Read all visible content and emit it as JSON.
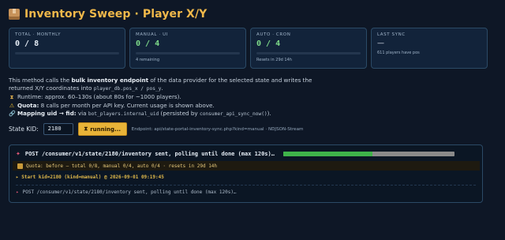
{
  "header": {
    "title": "Inventory Sweep · Player X/Y",
    "icon": "package-box-icon"
  },
  "cards": [
    {
      "label": "TOTAL · MONTHLY",
      "value": "0 / 8",
      "sub": "",
      "progress": 0
    },
    {
      "label": "MANUAL · UI",
      "value": "0 / 4",
      "sub": "4 remaining",
      "progress": 0
    },
    {
      "label": "AUTO · CRON",
      "value": "0 / 4",
      "sub": "Resets in 29d 14h",
      "progress": 0
    },
    {
      "label": "LAST SYNC",
      "value": "—",
      "sub": "611 players have pos"
    }
  ],
  "description": {
    "p1_a": "This method calls the ",
    "p1_b": "bulk inventory endpoint",
    "p1_c": " of the data provider for the selected state and writes the",
    "p2_a": "returned X/Y coordinates into ",
    "p2_code": "player_db.pos_x / pos_y",
    "p2_b": ".",
    "runtime": "Runtime: approx. 60–130s (about 80s for ~1000 players).",
    "quota_label": "Quota:",
    "quota_text": " 8 calls per month per API key. Current usage is shown above.",
    "mapping_label": "Mapping uid → fid:",
    "mapping_a": " via ",
    "mapping_code1": "bot_players.internal_uid",
    "mapping_b": " (persisted by ",
    "mapping_code2": "consumer_api_sync_now()",
    "mapping_c": ")."
  },
  "controls": {
    "kid_label": "State KID:",
    "kid_value": "2180",
    "run_label": "running...",
    "endpoint": "Endpoint: api/state-portal-inventory-sync.php?kind=manual · NDJSON-Stream"
  },
  "console": {
    "post_line": "POST /consumer/v1/state/2180/inventory sent, polling until done (max 120s)…",
    "progress": 0.52,
    "quota_line": "Quota: before — total 0/8, manual 0/4, auto 0/4 · resets in 29d 14h",
    "start_line": "▸ Start kid=2180 (kind=manual) @ 2026-09-01 09:19:45",
    "post_line2": "POST /consumer/v1/state/2180/inventory sent, polling until done (max 120s)…"
  },
  "colors": {
    "accent": "#f0b84a",
    "progress_fill": "#3fb34a",
    "card_border": "#2b4a66"
  }
}
